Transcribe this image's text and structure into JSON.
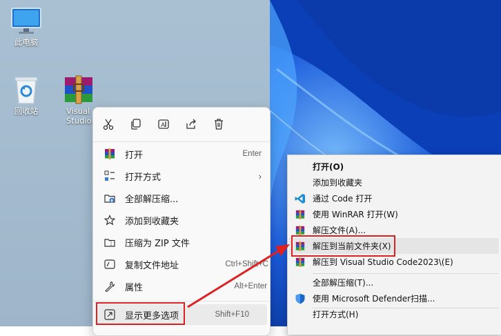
{
  "desktop": {
    "icons": [
      {
        "label": "此电脑"
      },
      {
        "label": "回收站"
      },
      {
        "label": "Visual\nStudio Co"
      }
    ]
  },
  "context_menu_new": {
    "quick_actions": [
      "cut-icon",
      "copy-icon",
      "rename-icon",
      "share-icon",
      "delete-icon"
    ],
    "items": [
      {
        "label": "打开",
        "shortcut": "Enter",
        "icon": "winrar-icon"
      },
      {
        "label": "打开方式",
        "shortcut": "",
        "icon": "open-with-icon",
        "submenu": true
      },
      {
        "label": "全部解压缩...",
        "shortcut": "",
        "icon": "extract-all-icon"
      },
      {
        "label": "添加到收藏夹",
        "shortcut": "",
        "icon": "star-icon"
      },
      {
        "label": "压缩为 ZIP 文件",
        "shortcut": "",
        "icon": "zip-icon"
      },
      {
        "label": "复制文件地址",
        "shortcut": "Ctrl+Shift+C",
        "icon": "copy-path-icon"
      },
      {
        "label": "属性",
        "shortcut": "Alt+Enter",
        "icon": "wrench-icon"
      },
      {
        "label": "显示更多选项",
        "shortcut": "Shift+F10",
        "icon": "more-options-icon"
      }
    ]
  },
  "context_menu_classic": {
    "items": [
      {
        "label": "打开(O)",
        "bold": true,
        "icon": ""
      },
      {
        "label": "添加到收藏夹",
        "icon": ""
      },
      {
        "label": "通过 Code 打开",
        "icon": "vscode-icon"
      },
      {
        "label": "使用 WinRAR 打开(W)",
        "icon": "winrar-icon"
      },
      {
        "label": "解压文件(A)...",
        "icon": "winrar-icon"
      },
      {
        "label": "解压到当前文件夹(X)",
        "icon": "winrar-icon",
        "highlighted": true
      },
      {
        "label": "解压到 Visual Studio Code2023\\(E)",
        "icon": "winrar-icon"
      },
      {
        "label": "全部解压缩(T)...",
        "icon": ""
      },
      {
        "label": "使用 Microsoft Defender扫描...",
        "icon": "defender-shield-icon"
      },
      {
        "label": "打开方式(H)",
        "icon": ""
      }
    ]
  },
  "colors": {
    "annotation_red": "#e02020",
    "win_blue": "#0a45c9"
  }
}
